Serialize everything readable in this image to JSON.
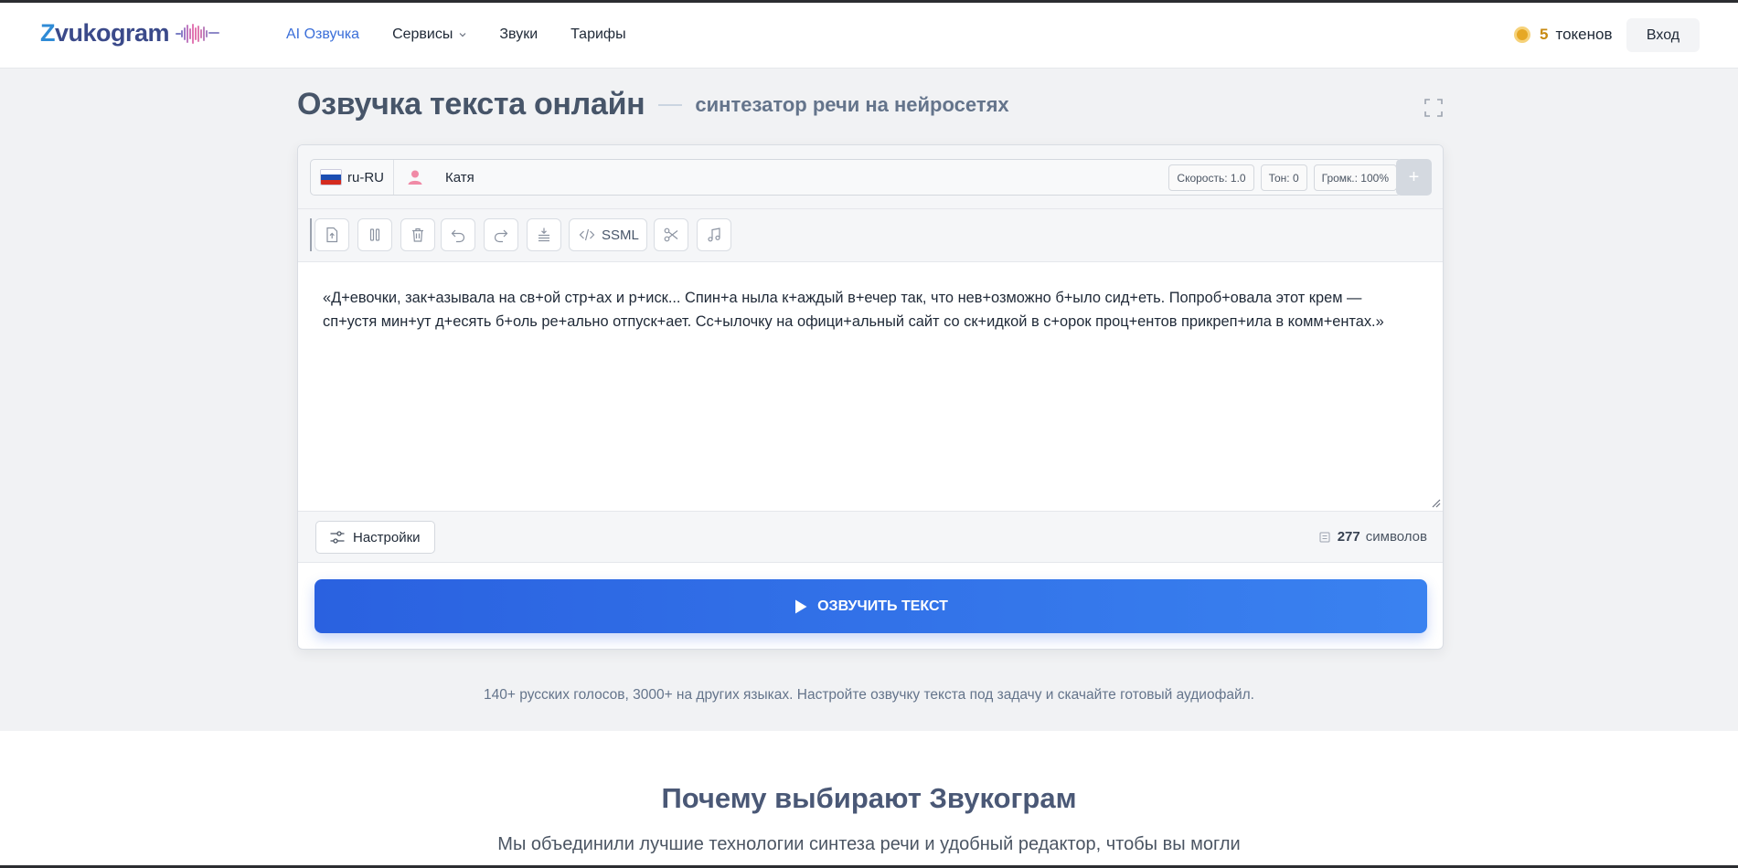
{
  "header": {
    "logo": "Zvukogram",
    "nav": [
      {
        "label": "AI Озвучка",
        "active": true
      },
      {
        "label": "Сервисы",
        "dropdown": true
      },
      {
        "label": "Звуки"
      },
      {
        "label": "Тарифы"
      }
    ],
    "tokens": {
      "count": "5",
      "label": "токенов"
    },
    "login": "Вход"
  },
  "title": {
    "main": "Озвучка текста онлайн",
    "subtitle": "синтезатор речи на нейросетях"
  },
  "editor": {
    "lang": "ru-RU",
    "voice": "Катя",
    "params": {
      "speed": "Скорость: 1.0",
      "tone": "Тон: 0",
      "volume": "Громк.: 100%"
    },
    "add": "+",
    "ssml": "SSML",
    "text": "«Д+евочки, зак+азывала на св+ой стр+ах и р+иск... Спин+а ныла к+аждый в+ечер так, что нев+озможно б+ыло сид+еть. Попроб+овала этот крем — сп+устя мин+ут д+есять б+оль ре+ально отпуск+ает. Сс+ылочку на офици+альный сайт со ск+идкой в с+орок проц+ентов прикреп+ила в комм+ентах.»",
    "settings": "Настройки",
    "char_count": "277",
    "char_label": "символов",
    "speak": "ОЗВУЧИТЬ ТЕКСТ"
  },
  "tagline": "140+ русских голосов, 3000+ на других языках. Настройте озвучку текста под задачу и скачайте готовый аудиофайл.",
  "why": {
    "title": "Почему выбирают Звукограм",
    "subtitle": "Мы объединили лучшие технологии синтеза речи и удобный редактор, чтобы вы могли"
  },
  "colors": {
    "accent": "#3b6fd9",
    "button": "#2a61e0",
    "coin": "#e6a825"
  }
}
